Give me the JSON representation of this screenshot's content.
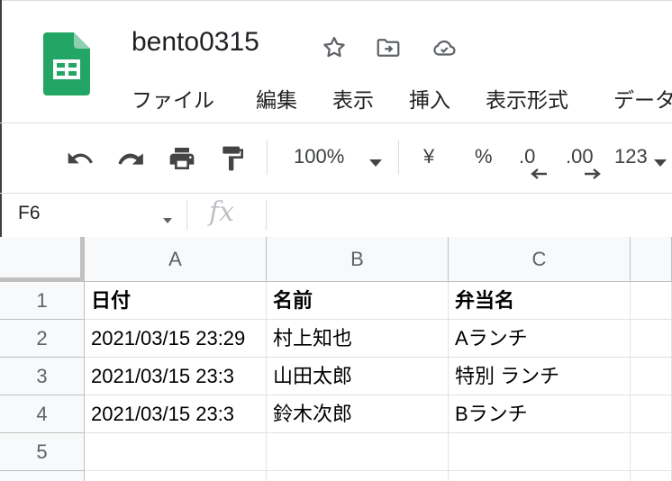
{
  "doc": {
    "title": "bento0315"
  },
  "menu": {
    "items": [
      "ファイル",
      "編集",
      "表示",
      "挿入",
      "表示形式",
      "データ"
    ]
  },
  "toolbar": {
    "zoom": "100%",
    "currency": "¥",
    "percent": "%",
    "decrease_decimal": ".0",
    "increase_decimal": ".00",
    "more_formats": "123"
  },
  "formula_bar": {
    "cell_ref": "F6",
    "fx": "fx"
  },
  "sheet": {
    "columns": [
      "A",
      "B",
      "C"
    ],
    "row_numbers": [
      "1",
      "2",
      "3",
      "4",
      "5"
    ],
    "rows": [
      [
        "日付",
        "名前",
        "弁当名"
      ],
      [
        "2021/03/15 23:29",
        "村上知也",
        "Aランチ"
      ],
      [
        "2021/03/15 23:3",
        "山田太郎",
        "特別 ランチ"
      ],
      [
        "2021/03/15 23:3",
        "鈴木次郎",
        "Bランチ"
      ],
      [
        "",
        "",
        ""
      ]
    ]
  },
  "colors": {
    "sheets_green": "#23a566",
    "grid_line": "#e2e2e2",
    "header_bg": "#f8f9fa"
  }
}
